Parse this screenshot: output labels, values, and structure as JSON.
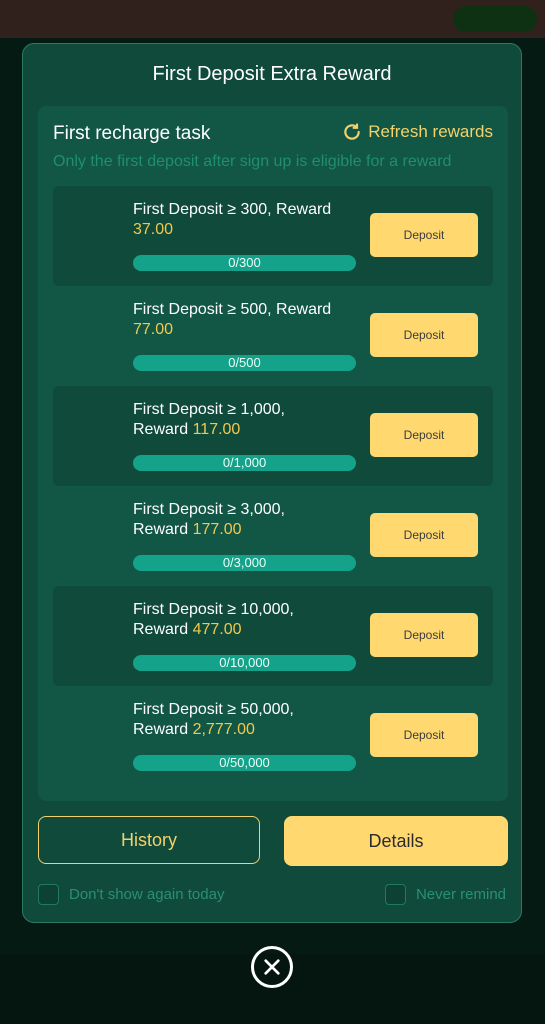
{
  "modal": {
    "title": "First Deposit Extra Reward",
    "task_title": "First recharge task",
    "refresh_label": "Refresh rewards",
    "subtitle": "Only the first deposit after sign up is eligible for a reward",
    "tasks": [
      {
        "line1": "First Deposit ≥ 300, Reward",
        "line2_prefix": "",
        "reward": "37.00",
        "progress": "0/300",
        "progress_fraction": 0,
        "button": "Deposit"
      },
      {
        "line1": "First Deposit ≥ 500, Reward",
        "line2_prefix": "",
        "reward": "77.00",
        "progress": "0/500",
        "progress_fraction": 0,
        "button": "Deposit"
      },
      {
        "line1": "First Deposit ≥ 1,000,",
        "line2_prefix": "Reward ",
        "reward": "117.00",
        "progress": "0/1,000",
        "progress_fraction": 0,
        "button": "Deposit"
      },
      {
        "line1": "First Deposit ≥ 3,000,",
        "line2_prefix": "Reward ",
        "reward": "177.00",
        "progress": "0/3,000",
        "progress_fraction": 0,
        "button": "Deposit"
      },
      {
        "line1": "First Deposit ≥ 10,000,",
        "line2_prefix": "Reward ",
        "reward": "477.00",
        "progress": "0/10,000",
        "progress_fraction": 0,
        "button": "Deposit"
      },
      {
        "line1": "First Deposit ≥ 50,000,",
        "line2_prefix": "Reward ",
        "reward": "2,777.00",
        "progress": "0/50,000",
        "progress_fraction": 0,
        "button": "Deposit"
      }
    ],
    "history_label": "History",
    "details_label": "Details",
    "dont_show_label": "Don't show again today",
    "never_remind_label": "Never remind",
    "close_icon": "close-icon"
  },
  "colors": {
    "accent": "#ffd970",
    "reward": "#f2c94c",
    "modal_bg": "#0f4a3b",
    "panel_bg": "#125645",
    "progress": "#14a38a"
  }
}
